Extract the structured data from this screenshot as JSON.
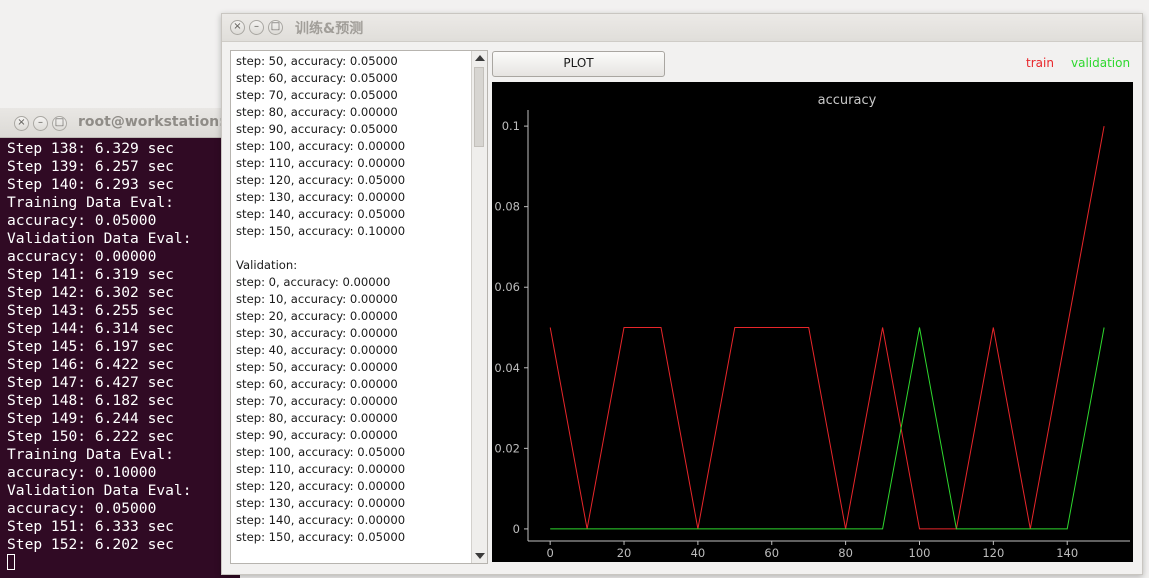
{
  "terminal": {
    "title": "root@workstation: /",
    "lines": [
      "Step 138: 6.329 sec",
      "Step 139: 6.257 sec",
      "Step 140: 6.293 sec",
      "Training Data Eval:",
      "accuracy: 0.05000",
      "Validation Data Eval:",
      "accuracy: 0.00000",
      "Step 141: 6.319 sec",
      "Step 142: 6.302 sec",
      "Step 143: 6.255 sec",
      "Step 144: 6.314 sec",
      "Step 145: 6.197 sec",
      "Step 146: 6.422 sec",
      "Step 147: 6.427 sec",
      "Step 148: 6.182 sec",
      "Step 149: 6.244 sec",
      "Step 150: 6.222 sec",
      "Training Data Eval:",
      "accuracy: 0.10000",
      "Validation Data Eval:",
      "accuracy: 0.05000",
      "Step 151: 6.333 sec",
      "Step 152: 6.202 sec"
    ]
  },
  "app": {
    "title": "训练&预测",
    "plot_button": "PLOT",
    "legend": {
      "train": "train",
      "validation": "validation"
    },
    "log_lines": [
      "step: 50, accuracy: 0.05000",
      "step: 60, accuracy: 0.05000",
      "step: 70, accuracy: 0.05000",
      "step: 80, accuracy: 0.00000",
      "step: 90, accuracy: 0.05000",
      "step: 100, accuracy: 0.00000",
      "step: 110, accuracy: 0.00000",
      "step: 120, accuracy: 0.05000",
      "step: 130, accuracy: 0.00000",
      "step: 140, accuracy: 0.05000",
      "step: 150, accuracy: 0.10000",
      "",
      "Validation:",
      "step: 0, accuracy: 0.00000",
      "step: 10, accuracy: 0.00000",
      "step: 20, accuracy: 0.00000",
      "step: 30, accuracy: 0.00000",
      "step: 40, accuracy: 0.00000",
      "step: 50, accuracy: 0.00000",
      "step: 60, accuracy: 0.00000",
      "step: 70, accuracy: 0.00000",
      "step: 80, accuracy: 0.00000",
      "step: 90, accuracy: 0.00000",
      "step: 100, accuracy: 0.05000",
      "step: 110, accuracy: 0.00000",
      "step: 120, accuracy: 0.00000",
      "step: 130, accuracy: 0.00000",
      "step: 140, accuracy: 0.00000",
      "step: 150, accuracy: 0.05000"
    ]
  },
  "colors": {
    "train": "#e8262a",
    "validation": "#2ed82e",
    "terminal_bg": "#300a24",
    "chart_bg": "#000000",
    "axis": "#bfbfbf"
  },
  "icons": {
    "close": "close-icon",
    "minimize": "minimize-icon",
    "maximize": "maximize-icon",
    "scroll_up": "chevron-up-icon",
    "scroll_down": "chevron-down-icon"
  },
  "chart_data": {
    "type": "line",
    "title": "accuracy",
    "xlabel": "",
    "ylabel": "",
    "x": [
      0,
      10,
      20,
      30,
      40,
      50,
      60,
      70,
      80,
      90,
      100,
      110,
      120,
      130,
      140,
      150
    ],
    "series": [
      {
        "name": "train",
        "values": [
          0.05,
          0.0,
          0.05,
          0.05,
          0.0,
          0.05,
          0.05,
          0.05,
          0.0,
          0.05,
          0.0,
          0.0,
          0.05,
          0.0,
          0.05,
          0.1
        ]
      },
      {
        "name": "validation",
        "values": [
          0.0,
          0.0,
          0.0,
          0.0,
          0.0,
          0.0,
          0.0,
          0.0,
          0.0,
          0.0,
          0.05,
          0.0,
          0.0,
          0.0,
          0.0,
          0.05
        ]
      }
    ],
    "xticks": [
      "0",
      "20",
      "40",
      "60",
      "80",
      "100",
      "120",
      "140"
    ],
    "yticks": [
      "0",
      "0.02",
      "0.04",
      "0.06",
      "0.08",
      "0.1"
    ],
    "xlim": [
      -6,
      157
    ],
    "ylim": [
      -0.003,
      0.1035
    ],
    "grid": false,
    "legend_position": "top-right"
  }
}
